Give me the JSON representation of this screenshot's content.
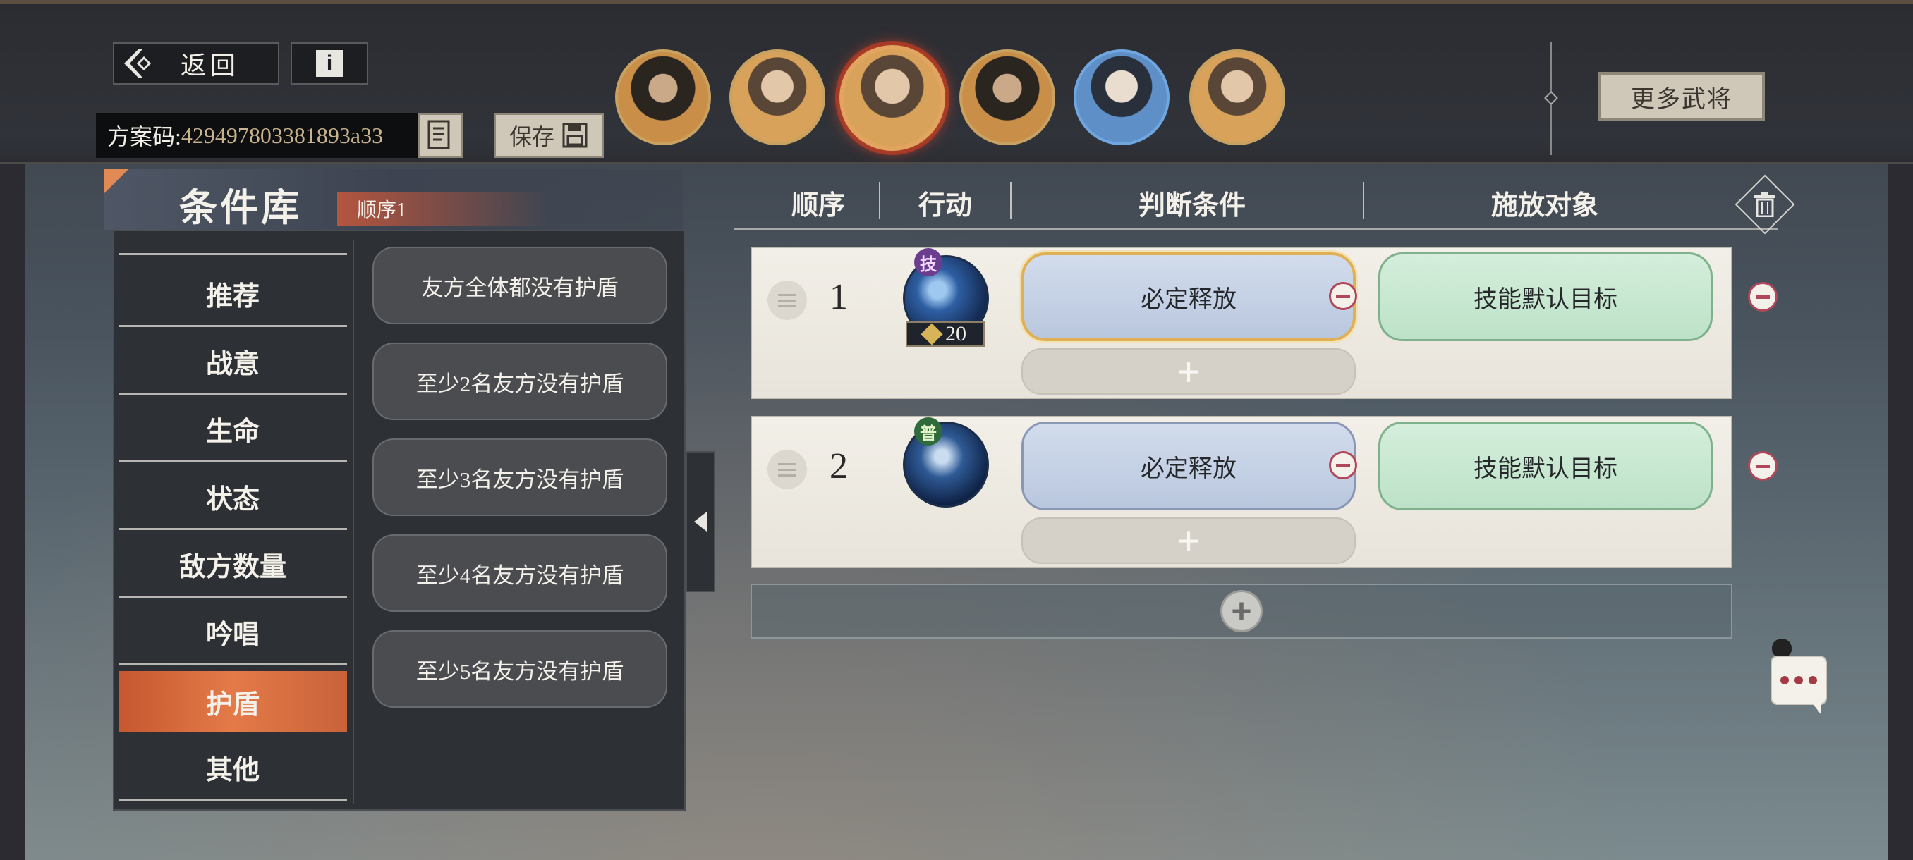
{
  "header": {
    "back_label": "返回",
    "info_label": "i",
    "plan_code_label": "方案码:",
    "plan_code_value": "429497803381893a33",
    "save_label": "保存",
    "more_generals_label": "更多武将",
    "selected_avatar_index": 2,
    "avatar_count": 6
  },
  "library": {
    "title": "条件库",
    "order_tag": "顺序1",
    "categories": [
      "推荐",
      "战意",
      "生命",
      "状态",
      "敌方数量",
      "吟唱",
      "护盾",
      "其他"
    ],
    "active_category": "护盾",
    "conditions": [
      "友方全体都没有护盾",
      "至少2名友方没有护盾",
      "至少3名友方没有护盾",
      "至少4名友方没有护盾",
      "至少5名友方没有护盾"
    ]
  },
  "table": {
    "headers": [
      "顺序",
      "行动",
      "判断条件",
      "施放对象"
    ],
    "rows": [
      {
        "order": "1",
        "skill_badge": "技",
        "cost": "20",
        "condition": "必定释放",
        "target": "技能默认目标",
        "add_symbol": "+"
      },
      {
        "order": "2",
        "skill_badge": "普",
        "condition": "必定释放",
        "target": "技能默认目标",
        "add_symbol": "+"
      }
    ],
    "add_row_symbol": "+"
  },
  "colors": {
    "accent_orange": "#e47a48",
    "condition_blue": "#b9c7de",
    "target_green": "#bde2c7",
    "delete_red": "#b0485a"
  },
  "icons": [
    "back-arrow-icon",
    "info-icon",
    "copy-code-icon",
    "save-disk-icon",
    "trash-icon",
    "drag-handle-icon",
    "minus-circle-icon",
    "plus-icon",
    "chat-icon",
    "collapse-arrow-icon"
  ]
}
